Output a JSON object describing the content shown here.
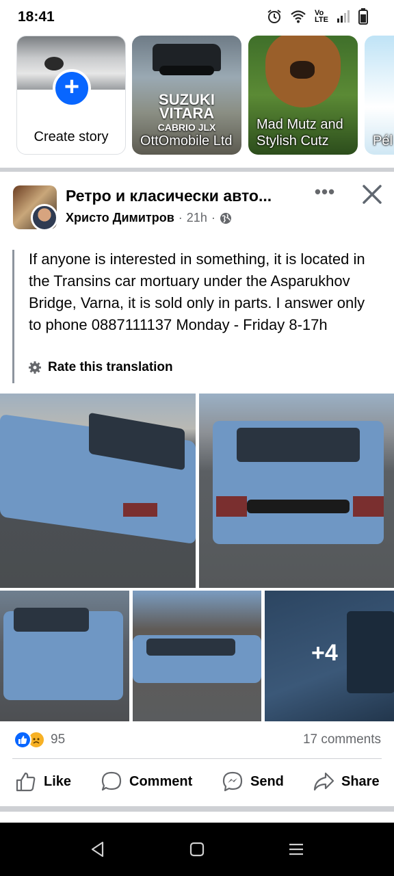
{
  "status_bar": {
    "time": "18:41",
    "lte_label_top": "Vo",
    "lte_label_bottom": "LTE",
    "icons": [
      "alarm-icon",
      "wifi-icon",
      "signal-icon",
      "battery-icon"
    ]
  },
  "stories": {
    "create": {
      "label": "Create story"
    },
    "items": [
      {
        "name": "OttOmobile Ltd",
        "brand_top": "SUZUKI VITARA",
        "brand_bottom": "CABRIO JLX"
      },
      {
        "name": "Mad Mutz and Stylish Cutz"
      },
      {
        "name": "Pél Bru"
      }
    ]
  },
  "post": {
    "group_name": "Ретро и класически авто...",
    "author": "Христо Димитров",
    "time": "21h",
    "privacy_icon": "globe-icon",
    "text": "If anyone is interested in something, it is located in the Transins car mortuary under the Asparukhov Bridge, Varna, it is sold only in parts. I answer only to phone 0887111137 Monday - Friday 8-17h",
    "rate_translation": "Rate this translation",
    "more_photos": "+4",
    "reaction_count": "95",
    "comments": "17 comments",
    "actions": {
      "like": "Like",
      "comment": "Comment",
      "send": "Send",
      "share": "Share"
    }
  },
  "colors": {
    "brand_blue": "#0866ff",
    "secondary_text": "#65676b",
    "divider": "#ced0d4"
  }
}
